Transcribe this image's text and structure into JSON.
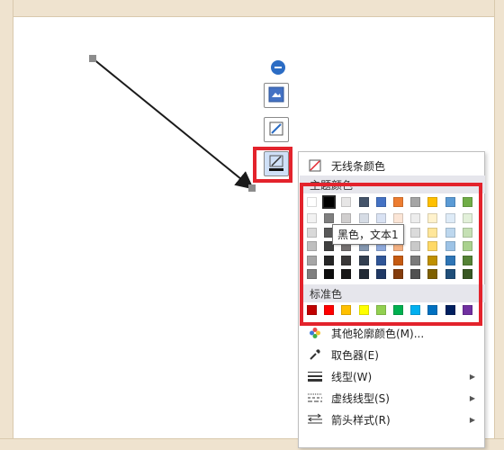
{
  "menu": {
    "no_line_color": "无线条颜色",
    "theme_colors_label": "主题颜色",
    "standard_colors_label": "标准色",
    "more_outline_colors": "其他轮廓颜色(M)...",
    "eyedropper": "取色器(E)",
    "line_type": "线型(W)",
    "dash_type": "虚线线型(S)",
    "arrow_style": "箭头样式(R)"
  },
  "tooltip": "黑色，文本1",
  "theme_colors": {
    "base": [
      "#ffffff",
      "#000000",
      "#e7e6e6",
      "#44546a",
      "#4472c4",
      "#ed7d31",
      "#a5a5a5",
      "#ffc000",
      "#5b9bd5",
      "#70ad47"
    ],
    "tints": [
      [
        "#f2f2f2",
        "#7f7f7f",
        "#d0cece",
        "#d6dce5",
        "#d9e2f3",
        "#fbe5d6",
        "#ededed",
        "#fff2cc",
        "#deebf7",
        "#e2f0d9"
      ],
      [
        "#d9d9d9",
        "#595959",
        "#aeabab",
        "#adb9ca",
        "#b4c7e7",
        "#f8cbad",
        "#dbdbdb",
        "#ffe699",
        "#bdd7ee",
        "#c5e0b4"
      ],
      [
        "#bfbfbf",
        "#404040",
        "#757171",
        "#8497b0",
        "#8faadc",
        "#f4b183",
        "#c9c9c9",
        "#ffd966",
        "#9dc3e6",
        "#a9d18e"
      ],
      [
        "#a6a6a6",
        "#262626",
        "#3a3838",
        "#333f50",
        "#2f5597",
        "#c55a11",
        "#7b7b7b",
        "#bf9000",
        "#2e75b6",
        "#548235"
      ],
      [
        "#7f7f7f",
        "#0d0d0d",
        "#171616",
        "#222a35",
        "#1f3864",
        "#843c0c",
        "#525252",
        "#7f6000",
        "#1f4e79",
        "#385723"
      ]
    ]
  },
  "standard_colors": [
    "#c00000",
    "#ff0000",
    "#ffc000",
    "#ffff00",
    "#92d050",
    "#00b050",
    "#00b0f0",
    "#0070c0",
    "#002060",
    "#7030a0"
  ],
  "colors": {
    "highlight_red": "#e3232c",
    "toolbar_blue": "#2b6cc4"
  }
}
